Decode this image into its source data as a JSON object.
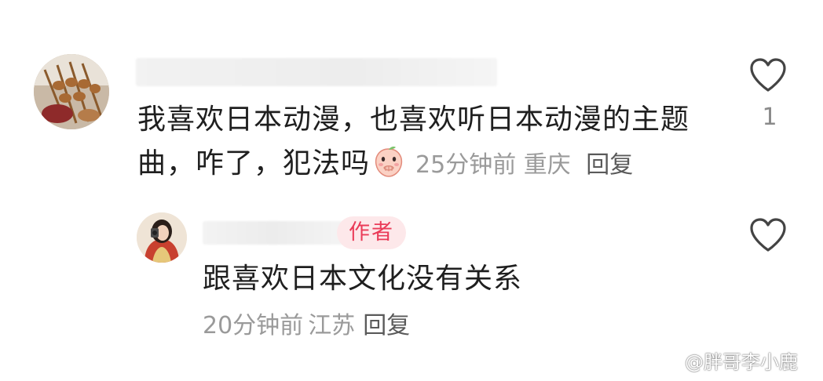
{
  "comment": {
    "text": "我喜欢日本动漫，也喜欢听日本动漫的主题曲，咋了，犯法吗",
    "time": "25分钟前",
    "location": "重庆",
    "reply_label": "回复",
    "like_count": "1",
    "emoji_icon": "peach-face-covering-mouth-emoji"
  },
  "reply": {
    "badge": "作者",
    "text": "跟喜欢日本文化没有关系",
    "time": "20分钟前",
    "location": "江苏",
    "reply_label": "回复"
  },
  "watermark": {
    "text": "@胖哥李小鹿"
  },
  "colors": {
    "text": "#1f1f1f",
    "meta": "#9a9a9a",
    "badge_bg": "#fde8ea",
    "badge_text": "#ea3b58",
    "icon": "#444444"
  }
}
